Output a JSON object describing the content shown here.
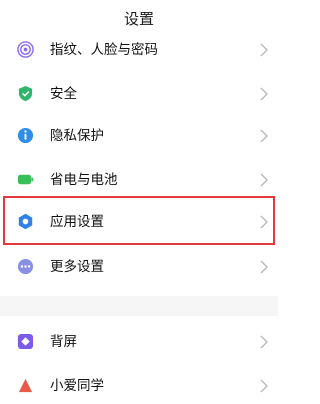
{
  "header": {
    "title": "设置"
  },
  "items": [
    {
      "label": "指纹、人脸与密码",
      "icon": "fingerprint-icon",
      "color": "#8a6cf0"
    },
    {
      "label": "安全",
      "icon": "shield-icon",
      "color": "#2fb66a"
    },
    {
      "label": "隐私保护",
      "icon": "privacy-info-icon",
      "color": "#2f8ee8"
    },
    {
      "label": "省电与电池",
      "icon": "battery-icon",
      "color": "#37c05a"
    },
    {
      "label": "应用设置",
      "icon": "gear-icon",
      "color": "#2f80e8"
    },
    {
      "label": "更多设置",
      "icon": "more-dots-icon",
      "color": "#8a8fe6"
    },
    {
      "label": "背屏",
      "icon": "back-screen-icon",
      "color": "#7b5ce8"
    },
    {
      "label": "小爱同学",
      "icon": "xiaoai-icon",
      "color": "#e85a4a"
    }
  ],
  "highlight_color": "#e23a3a"
}
